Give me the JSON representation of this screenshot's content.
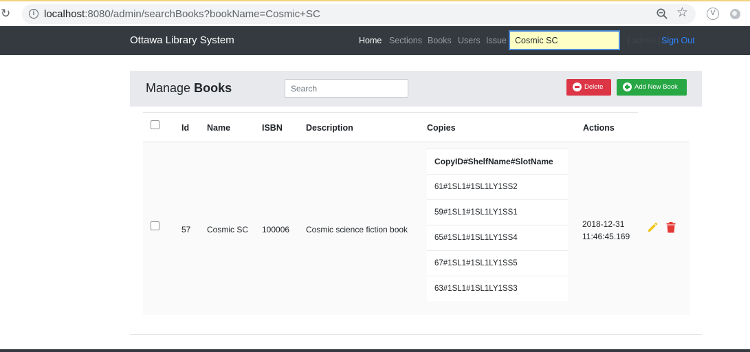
{
  "browser": {
    "url_host": "localhost",
    "url_rest": ":8080/admin/searchBooks?bookName=Cosmic+SC"
  },
  "navbar": {
    "brand": "Ottawa Library System",
    "items": [
      {
        "label": "Home",
        "active": true
      },
      {
        "label": "Sections",
        "active": false
      },
      {
        "label": "Books",
        "active": false
      },
      {
        "label": "Users",
        "active": false
      },
      {
        "label": "Issue",
        "active": false
      }
    ],
    "search_value": "Cosmic SC",
    "user": "| admin |",
    "signout": "Sign Out"
  },
  "manage": {
    "title_prefix": "Manage",
    "title_bold": "Books",
    "search_placeholder": "Search",
    "delete_label": "Delete",
    "add_label": "Add New Book"
  },
  "table": {
    "headers": [
      "Id",
      "Name",
      "ISBN",
      "Description",
      "Copies",
      "Actions"
    ],
    "row": {
      "id": "57",
      "name": "Cosmic SC",
      "isbn": "100006",
      "description": "Cosmic science fiction book",
      "copies_header": "CopyID#ShelfName#SlotName",
      "copies": [
        "61#1SL1#1SL1LY1SS2",
        "59#1SL1#1SL1LY1SS1",
        "65#1SL1#1SL1LY1SS4",
        "67#1SL1#1SL1LY1SS5",
        "63#1SL1#1SL1LY1SS3"
      ],
      "date_line1": "2018-12-31",
      "date_line2": "11:46:45.169"
    }
  },
  "colors": {
    "navbar": "#343a40",
    "delete": "#dc3545",
    "add": "#28a745",
    "edit_icon": "#f0c419",
    "trash_icon": "#e53935",
    "signout": "#2f85ff"
  }
}
